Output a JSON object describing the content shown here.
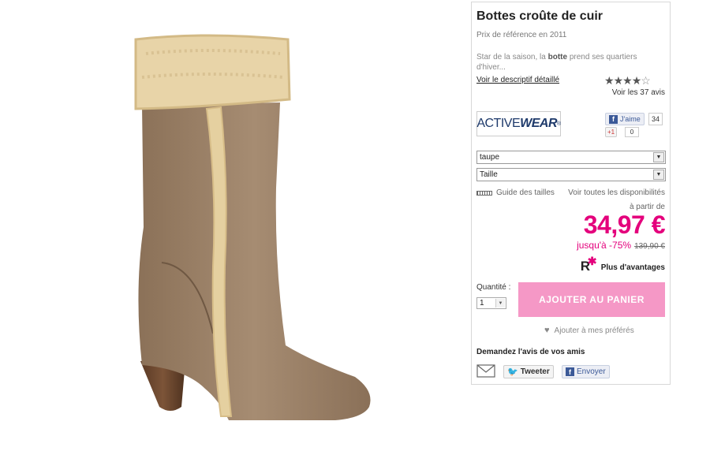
{
  "product": {
    "title": "Bottes croûte de cuir",
    "reference": "Prix de référence en 2011",
    "description_pre": "Star de la saison, la ",
    "description_bold": "botte",
    "description_post": " prend ses quartiers d'hiver...",
    "description_link": "Voir le descriptif détaillé",
    "rating": 4,
    "rating_max": 5,
    "reviews_label": "Voir les 37 avis"
  },
  "brand": {
    "part1": "ACTIVE",
    "part2": "WEAR",
    "tm": "®"
  },
  "social": {
    "fb_like_label": "J'aime",
    "fb_like_count": "34",
    "gplus_label": "+1",
    "gplus_count": "0"
  },
  "options": {
    "color_value": "taupe",
    "size_value": "Taille",
    "size_guide": "Guide des tailles",
    "availability": "Voir toutes les disponibilités"
  },
  "pricing": {
    "from_label": "à partir de",
    "price": "34,97 €",
    "discount": "jusqu'à -75%",
    "old_price": "139,90 €",
    "advantages": "Plus d'avantages",
    "advantages_logo": "R"
  },
  "cart": {
    "qty_label": "Quantité :",
    "qty_value": "1",
    "add_label": "AJOUTER AU PANIER",
    "fav_label": "Ajouter à mes préférés"
  },
  "share": {
    "ask_label": "Demandez l'avis de vos amis",
    "tweet_label": "Tweeter",
    "fb_send_label": "Envoyer"
  },
  "colors": {
    "accent": "#e4007c",
    "cart_button": "#f598c6",
    "boot": "#9a8168",
    "fur": "#e8d4a8"
  },
  "icons": [
    "boot-image",
    "star-icon",
    "ruler-icon",
    "heart-icon",
    "envelope-icon",
    "twitter-icon",
    "facebook-icon",
    "google-plus-icon"
  ]
}
